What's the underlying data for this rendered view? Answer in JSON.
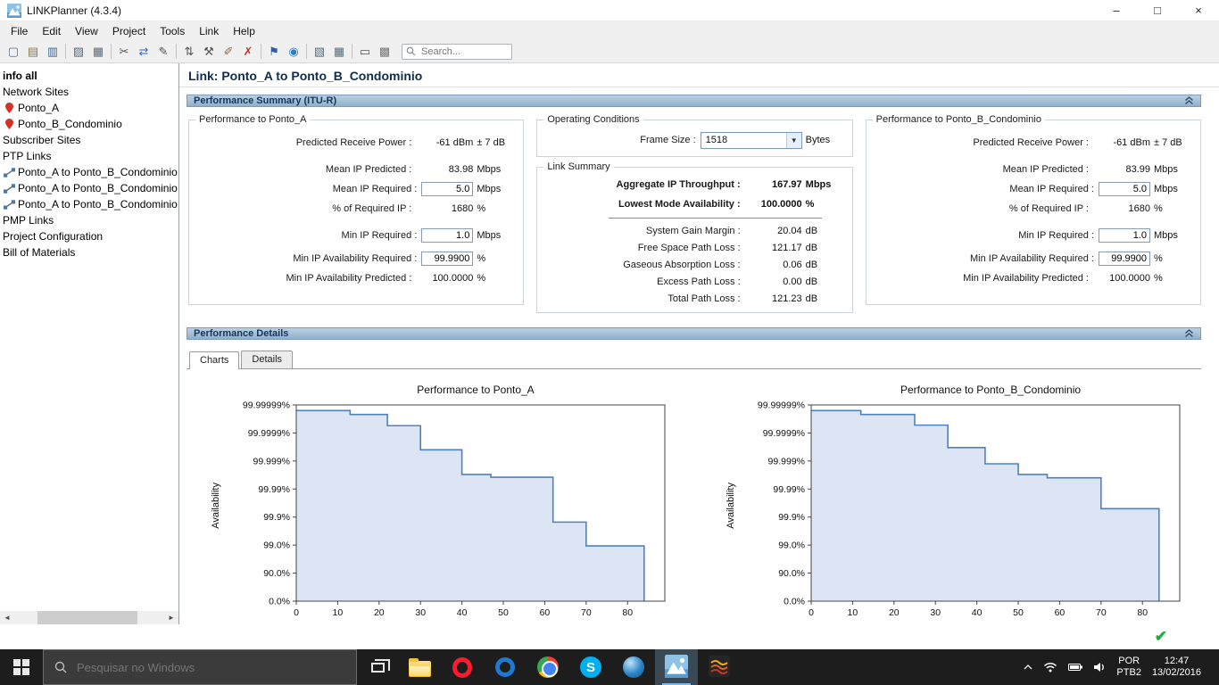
{
  "window": {
    "title": "LINKPlanner (4.3.4)",
    "controls": {
      "minimize": "–",
      "maximize": "□",
      "close": "×"
    }
  },
  "menu": {
    "items": [
      "File",
      "Edit",
      "View",
      "Project",
      "Tools",
      "Link",
      "Help"
    ]
  },
  "toolbar": {
    "search_placeholder": "Search...",
    "icons": [
      {
        "name": "new-file",
        "glyph": "▢",
        "color": "#49708f"
      },
      {
        "name": "open-file",
        "glyph": "▤",
        "color": "#8a7a43"
      },
      {
        "name": "save",
        "glyph": "▥",
        "color": "#3f6a9a"
      },
      {
        "sep": true
      },
      {
        "name": "copy",
        "glyph": "▨",
        "color": "#5a6b7a"
      },
      {
        "name": "paste",
        "glyph": "▦",
        "color": "#5a6b7a"
      },
      {
        "sep": true
      },
      {
        "name": "cut",
        "glyph": "✂",
        "color": "#555555"
      },
      {
        "name": "link-nodes",
        "glyph": "⇄",
        "color": "#2f6db3"
      },
      {
        "name": "pencil",
        "glyph": "✎",
        "color": "#555555"
      },
      {
        "sep": true
      },
      {
        "name": "reorder",
        "glyph": "⇅",
        "color": "#555555"
      },
      {
        "name": "tools",
        "glyph": "⚒",
        "color": "#555555"
      },
      {
        "name": "edit-wand",
        "glyph": "✐",
        "color": "#8a6d3b"
      },
      {
        "name": "delete",
        "glyph": "✗",
        "color": "#c0392b"
      },
      {
        "sep": true
      },
      {
        "name": "flag",
        "glyph": "⚑",
        "color": "#2e5fa3"
      },
      {
        "name": "globe",
        "glyph": "◉",
        "color": "#2e7fc1"
      },
      {
        "sep": true
      },
      {
        "name": "layers",
        "glyph": "▧",
        "color": "#55707d"
      },
      {
        "name": "grid",
        "glyph": "▦",
        "color": "#55707d"
      },
      {
        "sep": true
      },
      {
        "name": "print",
        "glyph": "▭",
        "color": "#555555"
      },
      {
        "name": "image",
        "glyph": "▩",
        "color": "#777777"
      }
    ]
  },
  "sidebar": {
    "items": [
      {
        "id": "info-all",
        "label": "info all",
        "icon": "",
        "bold": true
      },
      {
        "id": "network-sites",
        "label": "Network Sites",
        "icon": ""
      },
      {
        "id": "ponto-a",
        "label": "Ponto_A",
        "icon": "site"
      },
      {
        "id": "ponto-b-condominio",
        "label": "Ponto_B_Condominio",
        "icon": "site"
      },
      {
        "id": "subscriber-sites",
        "label": "Subscriber Sites",
        "icon": ""
      },
      {
        "id": "ptp-links",
        "label": "PTP Links",
        "icon": ""
      },
      {
        "id": "link-1",
        "label": "Ponto_A to Ponto_B_Condominio",
        "icon": "link"
      },
      {
        "id": "link-2",
        "label": "Ponto_A to Ponto_B_Condominio",
        "icon": "link"
      },
      {
        "id": "link-3",
        "label": "Ponto_A to Ponto_B_Condominio",
        "icon": "link"
      },
      {
        "id": "pmp-links",
        "label": "PMP Links",
        "icon": ""
      },
      {
        "id": "project-configuration",
        "label": "Project Configuration",
        "icon": ""
      },
      {
        "id": "bill-of-materials",
        "label": "Bill of Materials",
        "icon": ""
      }
    ]
  },
  "main": {
    "link_title": "Link: Ponto_A to Ponto_B_Condominio",
    "summary_section": "Performance Summary (ITU-R)",
    "details_section": "Performance Details",
    "tabs": {
      "charts": "Charts",
      "details": "Details"
    }
  },
  "ponto_a": {
    "title": "Performance to Ponto_A",
    "rows": {
      "rx_power": {
        "label": "Predicted Receive Power :",
        "value": "-61 dBm",
        "unit": "± 7 dB"
      },
      "mean_ip_predicted": {
        "label": "Mean IP Predicted :",
        "value": "83.98",
        "unit": "Mbps"
      },
      "mean_ip_required": {
        "label": "Mean IP Required :",
        "value": "5.0",
        "unit": "Mbps"
      },
      "pct_required": {
        "label": "% of Required IP :",
        "value": "1680",
        "unit": "%"
      },
      "min_ip_required": {
        "label": "Min IP Required :",
        "value": "1.0",
        "unit": "Mbps"
      },
      "min_avail_required": {
        "label": "Min IP Availability Required :",
        "value": "99.9900",
        "unit": "%"
      },
      "min_avail_predicted": {
        "label": "Min IP Availability Predicted :",
        "value": "100.0000",
        "unit": "%"
      }
    }
  },
  "ponto_b": {
    "title": "Performance to Ponto_B_Condominio",
    "rows": {
      "rx_power": {
        "label": "Predicted Receive Power :",
        "value": "-61 dBm",
        "unit": "± 7 dB"
      },
      "mean_ip_predicted": {
        "label": "Mean IP Predicted :",
        "value": "83.99",
        "unit": "Mbps"
      },
      "mean_ip_required": {
        "label": "Mean IP Required :",
        "value": "5.0",
        "unit": "Mbps"
      },
      "pct_required": {
        "label": "% of Required IP :",
        "value": "1680",
        "unit": "%"
      },
      "min_ip_required": {
        "label": "Min IP Required :",
        "value": "1.0",
        "unit": "Mbps"
      },
      "min_avail_required": {
        "label": "Min IP Availability Required :",
        "value": "99.9900",
        "unit": "%"
      },
      "min_avail_predicted": {
        "label": "Min IP Availability Predicted :",
        "value": "100.0000",
        "unit": "%"
      }
    }
  },
  "operating": {
    "title": "Operating Conditions",
    "frame_size_label": "Frame Size :",
    "frame_size_value": "1518",
    "frame_size_unit": "Bytes"
  },
  "link_summary": {
    "title": "Link Summary",
    "rows": {
      "aggregate": {
        "label": "Aggregate IP Throughput :",
        "value": "167.97",
        "unit": "Mbps"
      },
      "lowest_mode": {
        "label": "Lowest Mode Availability :",
        "value": "100.0000",
        "unit": "%"
      },
      "system_gain": {
        "label": "System Gain Margin :",
        "value": "20.04",
        "unit": "dB"
      },
      "fspl": {
        "label": "Free Space Path Loss :",
        "value": "121.17",
        "unit": "dB"
      },
      "gaseous": {
        "label": "Gaseous Absorption Loss :",
        "value": "0.06",
        "unit": "dB"
      },
      "excess": {
        "label": "Excess Path Loss :",
        "value": "0.00",
        "unit": "dB"
      },
      "total": {
        "label": "Total Path Loss :",
        "value": "121.23",
        "unit": "dB"
      }
    }
  },
  "chart_data": [
    {
      "type": "area",
      "title": "Performance to Ponto_A",
      "ylabel": "Availability",
      "ytick_labels": [
        "99.99999%",
        "99.9999%",
        "99.999%",
        "99.99%",
        "99.9%",
        "99.0%",
        "90.0%",
        "0.0%"
      ],
      "xticks": [
        0,
        10,
        20,
        30,
        40,
        50,
        60,
        70,
        80
      ],
      "xmax": 89,
      "steps": [
        [
          0,
          6.8
        ],
        [
          13,
          6.66
        ],
        [
          22,
          6.26
        ],
        [
          30,
          5.4
        ],
        [
          40,
          4.52
        ],
        [
          47,
          4.42
        ],
        [
          62,
          2.82
        ],
        [
          70,
          1.97
        ],
        [
          84,
          0
        ]
      ],
      "line_color": "#4f81bd",
      "fill_color": "#dbe5f4"
    },
    {
      "type": "area",
      "title": "Performance to Ponto_B_Condominio",
      "ylabel": "Availability",
      "ytick_labels": [
        "99.99999%",
        "99.9999%",
        "99.999%",
        "99.99%",
        "99.9%",
        "99.0%",
        "90.0%",
        "0.0%"
      ],
      "xticks": [
        0,
        10,
        20,
        30,
        40,
        50,
        60,
        70,
        80
      ],
      "xmax": 89,
      "steps": [
        [
          0,
          6.8
        ],
        [
          12,
          6.66
        ],
        [
          25,
          6.28
        ],
        [
          33,
          5.48
        ],
        [
          42,
          4.9
        ],
        [
          50,
          4.52
        ],
        [
          57,
          4.4
        ],
        [
          70,
          3.3
        ],
        [
          84,
          0
        ]
      ],
      "line_color": "#4f81bd",
      "fill_color": "#dbe5f4"
    }
  ],
  "status": {
    "ok": "✔"
  },
  "scrollbar": {
    "left": "◄",
    "right": "►",
    "combo_arrow": "▼"
  },
  "taskbar": {
    "search_placeholder": "Pesquisar no Windows",
    "app_icons": [
      "start",
      "task-view",
      "file-explorer",
      "opera-browser",
      "blue-ring-app",
      "chrome",
      "skype",
      "blue-swirl-app",
      "linkplanner",
      "orange-waves-app"
    ],
    "tray": {
      "lang_line1": "POR",
      "lang_line2": "PTB2",
      "time": "12:47",
      "date": "13/02/2016"
    }
  }
}
